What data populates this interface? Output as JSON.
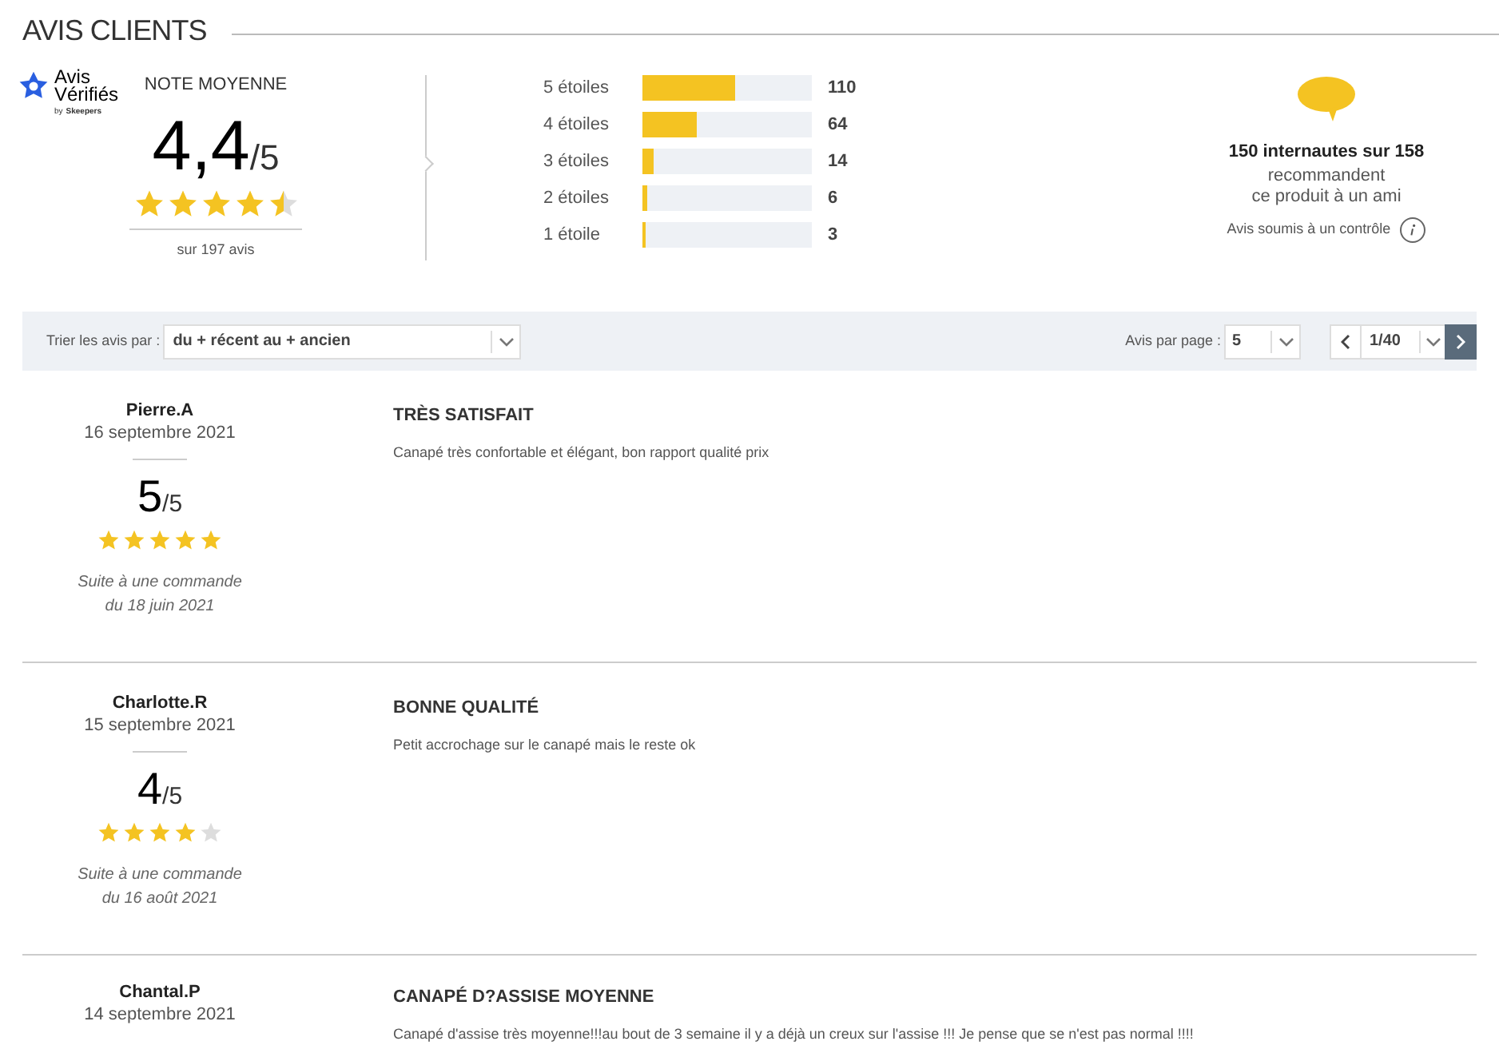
{
  "section_title": "AVIS CLIENTS",
  "summary": {
    "logo": {
      "line1": "Avis",
      "line2": "Vérifiés",
      "byline": "by",
      "brand": "Skeepers"
    },
    "label": "NOTE MOYENNE",
    "score": "4,4",
    "out_of": "/5",
    "stars": 4.5,
    "count": "sur 197 avis"
  },
  "distribution": [
    {
      "label": "5 étoiles",
      "level": 0.55,
      "count": "110"
    },
    {
      "label": "4 étoiles",
      "level": 0.32,
      "count": "64"
    },
    {
      "label": "3 étoiles",
      "level": 0.07,
      "count": "14"
    },
    {
      "label": "2 étoiles",
      "level": 0.03,
      "count": "6"
    },
    {
      "label": "1 étoile",
      "level": 0.015,
      "count": "3"
    }
  ],
  "recommend": {
    "headline": "150 internautes sur 158",
    "line1": "recommandent",
    "line2": "ce produit à un ami",
    "note": "Avis soumis à un contrôle"
  },
  "toolbar": {
    "sort_label": "Trier les avis par :",
    "sort_value": "du + récent au + ancien",
    "per_page_label": "Avis par page :",
    "per_page_value": "5",
    "page": "1/40"
  },
  "reviews": [
    {
      "author": "Pierre.A",
      "date": "16 septembre 2021",
      "score": "5",
      "out_of": "/5",
      "stars": 5,
      "order_line1": "Suite à une commande",
      "order_line2": "du 18 juin 2021",
      "title": "TRÈS SATISFAIT",
      "text": "Canapé très confortable et élégant, bon rapport qualité prix"
    },
    {
      "author": "Charlotte.R",
      "date": "15 septembre 2021",
      "score": "4",
      "out_of": "/5",
      "stars": 4,
      "order_line1": "Suite à une commande",
      "order_line2": "du 16 août 2021",
      "title": "BONNE QUALITÉ",
      "text": "Petit accrochage sur le canapé mais le reste ok"
    },
    {
      "author": "Chantal.P",
      "date": "14 septembre 2021",
      "title": "CANAPÉ D?ASSISE MOYENNE",
      "text": "Canapé d'assise très moyenne!!!au bout de 3 semaine il y a déjà un creux sur l'assise !!! Je pense que se n'est pas normal !!!!"
    }
  ]
}
